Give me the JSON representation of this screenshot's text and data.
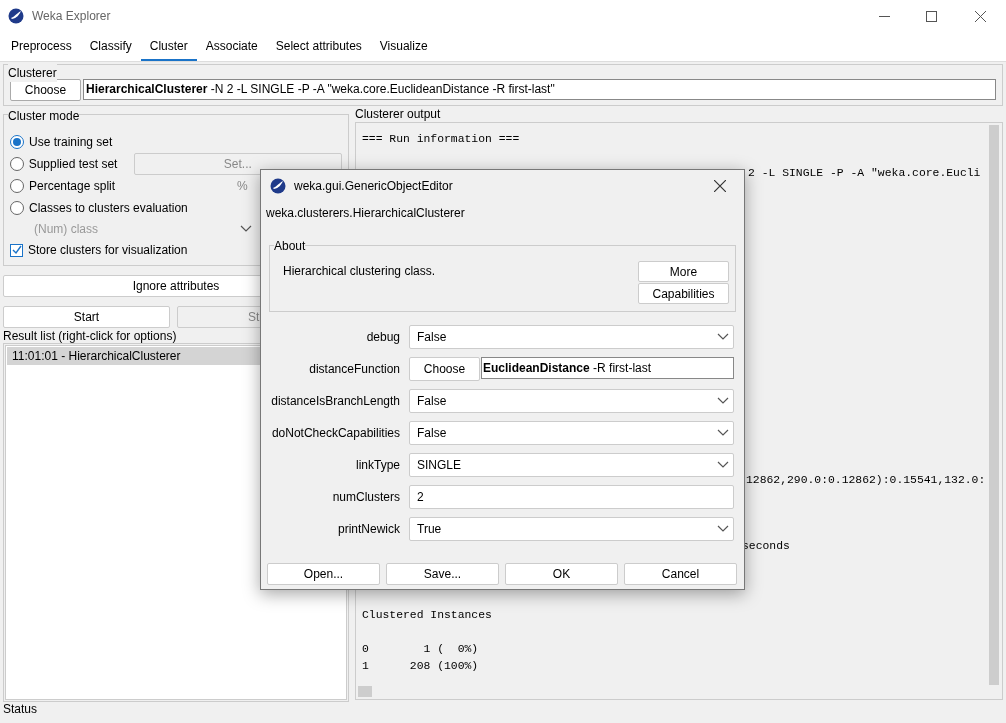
{
  "window": {
    "title": "Weka Explorer"
  },
  "tabs": [
    {
      "label": "Preprocess",
      "selected": false
    },
    {
      "label": "Classify",
      "selected": false
    },
    {
      "label": "Cluster",
      "selected": true
    },
    {
      "label": "Associate",
      "selected": false
    },
    {
      "label": "Select attributes",
      "selected": false
    },
    {
      "label": "Visualize",
      "selected": false
    }
  ],
  "clusterer": {
    "title": "Clusterer",
    "button": "Choose",
    "name": "HierarchicalClusterer",
    "options": "-N 2 -L SINGLE -P -A \"weka.core.EuclideanDistance -R first-last\""
  },
  "cluster_mode": {
    "title": "Cluster mode",
    "options": [
      {
        "label": "Use training set",
        "selected": true
      },
      {
        "label": "Supplied test set",
        "selected": false,
        "button": "Set..."
      },
      {
        "label": "Percentage split",
        "selected": false,
        "suffix": "%"
      },
      {
        "label": "Classes to clusters evaluation",
        "selected": false
      }
    ],
    "class_select": {
      "value": "(Num) class",
      "disabled": true
    },
    "store_clusters": {
      "label": "Store clusters for visualization",
      "checked": true
    }
  },
  "ignore_button": "Ignore attributes",
  "start_button": "Start",
  "stop_button": "St",
  "result_list": {
    "title": "Result list (right-click for options)",
    "items": [
      {
        "label": "11:01:01 - HierarchicalClusterer",
        "selected": true
      }
    ]
  },
  "output": {
    "title": "Clusterer output",
    "lines": [
      "=== Run information ===",
      "2 -L SINGLE -P -A \"weka.core.Eucli",
      "12862,290.0:0.12862):0.15541,132.0:",
      "seconds",
      "Clustered Instances",
      "0        1 (  0%)",
      "1      208 (100%)"
    ]
  },
  "status": "Status",
  "dialog": {
    "title": "weka.gui.GenericObjectEditor",
    "class_name": "weka.clusterers.HierarchicalClusterer",
    "about": {
      "title": "About",
      "text": "Hierarchical clustering class.",
      "buttons": [
        "More",
        "Capabilities"
      ]
    },
    "properties": [
      {
        "label": "debug",
        "kind": "select",
        "value": "False"
      },
      {
        "label": "distanceFunction",
        "kind": "object",
        "button": "Choose",
        "name": "EuclideanDistance",
        "options": "-R first-last"
      },
      {
        "label": "distanceIsBranchLength",
        "kind": "select",
        "value": "False"
      },
      {
        "label": "doNotCheckCapabilities",
        "kind": "select",
        "value": "False"
      },
      {
        "label": "linkType",
        "kind": "select",
        "value": "SINGLE"
      },
      {
        "label": "numClusters",
        "kind": "text",
        "value": "2"
      },
      {
        "label": "printNewick",
        "kind": "select",
        "value": "True"
      }
    ],
    "buttons": [
      "Open...",
      "Save...",
      "OK",
      "Cancel"
    ]
  }
}
